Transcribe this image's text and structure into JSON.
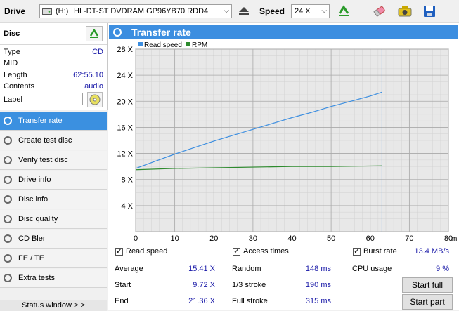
{
  "toolbar": {
    "drive_label": "Drive",
    "drive_letter": "(H:)",
    "drive_value": "HL-DT-ST DVDRAM GP96YB70 RDD4",
    "speed_label": "Speed",
    "speed_value": "24 X"
  },
  "disc": {
    "title": "Disc",
    "rows": [
      {
        "label": "Type",
        "value": "CD"
      },
      {
        "label": "MID",
        "value": ""
      },
      {
        "label": "Length",
        "value": "62:55.10"
      },
      {
        "label": "Contents",
        "value": "audio"
      }
    ],
    "label_field": "Label",
    "label_value": ""
  },
  "nav": {
    "items": [
      {
        "label": "Transfer rate",
        "active": true
      },
      {
        "label": "Create test disc"
      },
      {
        "label": "Verify test disc"
      },
      {
        "label": "Drive info"
      },
      {
        "label": "Disc info"
      },
      {
        "label": "Disc quality"
      },
      {
        "label": "CD Bler"
      },
      {
        "label": "FE / TE"
      },
      {
        "label": "Extra tests"
      }
    ],
    "status_window": "Status window > >"
  },
  "panel": {
    "title": "Transfer rate"
  },
  "chart_data": {
    "type": "line",
    "legend": [
      "Read speed",
      "RPM"
    ],
    "legend_position": "top-left",
    "grid": true,
    "x_unit": "min",
    "x_ticks": [
      "0",
      "10",
      "20",
      "30",
      "40",
      "50",
      "60",
      "70",
      "80"
    ],
    "y_ticks": [
      "4 X",
      "8 X",
      "12 X",
      "16 X",
      "20 X",
      "24 X",
      "28 X"
    ],
    "xlim": [
      0,
      80
    ],
    "ylim": [
      0,
      28
    ],
    "marker_x": 63,
    "series": [
      {
        "name": "Read speed",
        "color": "#3c8ee0",
        "x": [
          0,
          5,
          10,
          15,
          20,
          25,
          30,
          35,
          40,
          45,
          50,
          55,
          60,
          63
        ],
        "y": [
          9.7,
          10.8,
          11.9,
          12.9,
          13.9,
          14.8,
          15.7,
          16.6,
          17.5,
          18.3,
          19.2,
          20.0,
          20.8,
          21.4
        ]
      },
      {
        "name": "RPM",
        "color": "#2e8b2e",
        "x": [
          0,
          10,
          20,
          30,
          40,
          50,
          63
        ],
        "y": [
          9.5,
          9.7,
          9.8,
          9.9,
          10.0,
          10.0,
          10.1
        ]
      }
    ]
  },
  "stats": {
    "read_speed": {
      "label": "Read speed",
      "checked": true
    },
    "access_times": {
      "label": "Access times",
      "checked": true
    },
    "burst_rate": {
      "label": "Burst rate",
      "checked": true,
      "value": "13.4 MB/s"
    },
    "average": {
      "label": "Average",
      "value": "15.41 X"
    },
    "start": {
      "label": "Start",
      "value": "9.72 X"
    },
    "end": {
      "label": "End",
      "value": "21.36 X"
    },
    "random": {
      "label": "Random",
      "value": "148 ms"
    },
    "third_stroke": {
      "label": "1/3 stroke",
      "value": "190 ms"
    },
    "full_stroke": {
      "label": "Full stroke",
      "value": "315 ms"
    },
    "cpu_usage": {
      "label": "CPU usage",
      "value": "9 %"
    }
  },
  "buttons": {
    "start_full": "Start full",
    "start_part": "Start part"
  }
}
